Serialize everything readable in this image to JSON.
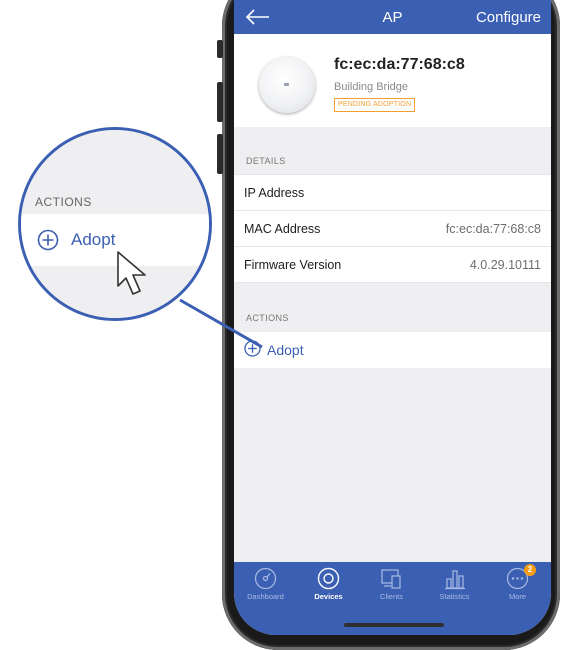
{
  "header": {
    "title": "AP",
    "configure_label": "Configure"
  },
  "device": {
    "name": "fc:ec:da:77:68:c8",
    "model": "Building Bridge",
    "status_badge": "PENDING ADOPTION"
  },
  "details": {
    "section_label": "DETAILS",
    "rows": [
      {
        "label": "IP Address",
        "value": ""
      },
      {
        "label": "MAC Address",
        "value": "fc:ec:da:77:68:c8"
      },
      {
        "label": "Firmware Version",
        "value": "4.0.29.10111"
      }
    ]
  },
  "actions": {
    "section_label": "ACTIONS",
    "adopt_label": "Adopt"
  },
  "zoom": {
    "section_label": "ACTIONS",
    "adopt_label": "Adopt"
  },
  "tabbar": {
    "tabs": [
      {
        "label": "Dashboard",
        "icon": "dashboard-icon"
      },
      {
        "label": "Devices",
        "icon": "devices-icon",
        "active": true
      },
      {
        "label": "Clients",
        "icon": "clients-icon"
      },
      {
        "label": "Statistics",
        "icon": "statistics-icon"
      },
      {
        "label": "More",
        "icon": "more-icon",
        "badge": "2"
      }
    ]
  },
  "colors": {
    "brand": "#3b5fb3",
    "pending": "#f0a030",
    "notification": "#f39c12"
  }
}
